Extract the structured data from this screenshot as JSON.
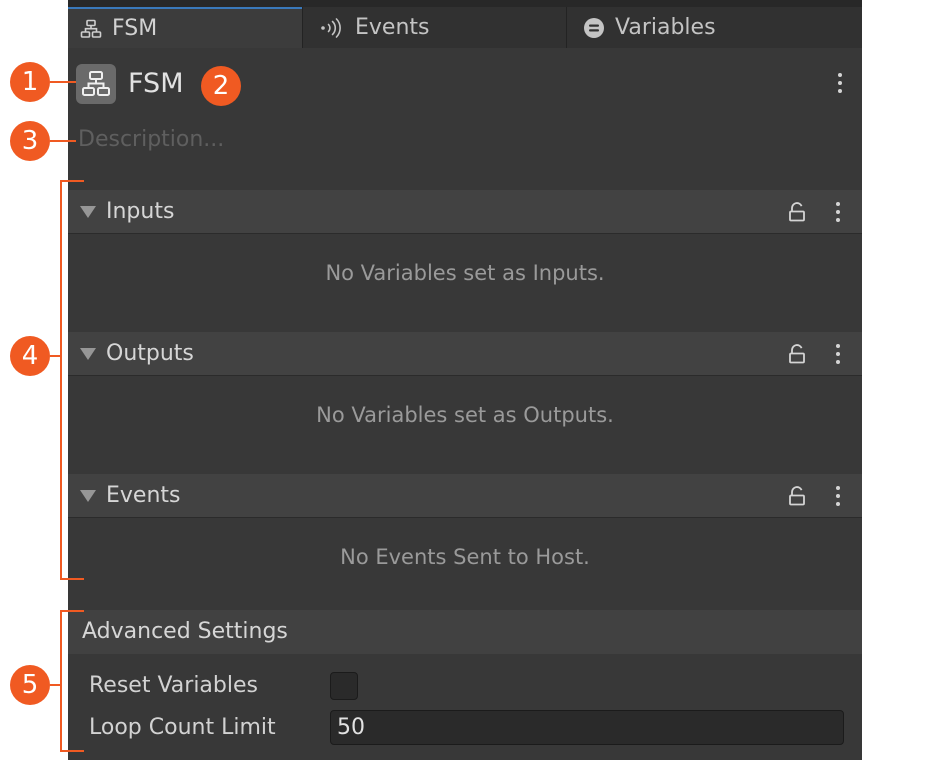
{
  "tabs": [
    {
      "label": "FSM",
      "icon": "hierarchy-icon",
      "active": true
    },
    {
      "label": "Events",
      "icon": "broadcast-icon",
      "active": false
    },
    {
      "label": "Variables",
      "icon": "variables-icon",
      "active": false
    }
  ],
  "header": {
    "title": "FSM",
    "icon": "fsm-hierarchy-icon",
    "description_placeholder": "Description..."
  },
  "sections": [
    {
      "title": "Inputs",
      "empty_text": "No Variables set as Inputs."
    },
    {
      "title": "Outputs",
      "empty_text": "No Variables set as Outputs."
    },
    {
      "title": "Events",
      "empty_text": "No Events Sent to Host."
    }
  ],
  "advanced": {
    "title": "Advanced Settings",
    "reset_variables_label": "Reset Variables",
    "reset_variables_checked": false,
    "loop_count_limit_label": "Loop Count Limit",
    "loop_count_limit_value": "50"
  },
  "callouts": [
    "1",
    "2",
    "3",
    "4",
    "5"
  ],
  "colors": {
    "panel_bg": "#383838",
    "tab_bar_bg": "#282828",
    "active_tab_accent": "#3a79bb",
    "callout": "#f05a22"
  }
}
